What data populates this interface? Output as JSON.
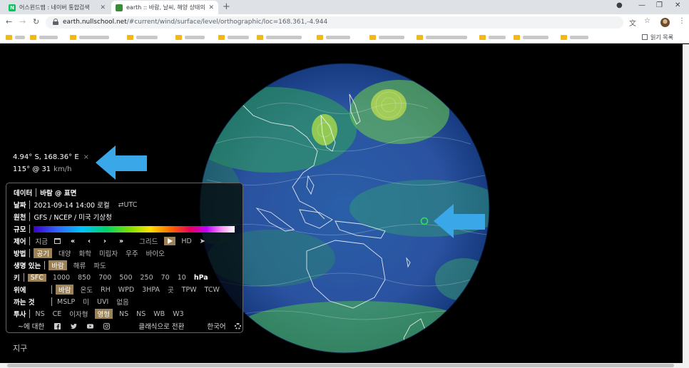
{
  "browser": {
    "tabs": [
      {
        "favicon_letter": "N",
        "favicon_color": "#03c75a",
        "title": "어스윈드맵 : 네이버 통합검색"
      },
      {
        "favicon_color": "#3b8a3a",
        "title": "earth :: 바람, 날씨, 해양 상태의"
      }
    ],
    "new_tab": "+",
    "url_host": "earth.nullschool.net",
    "url_path": "/#current/wind/surface/level/orthographic/loc=168.361,-4.944",
    "reading_list": "읽기 목록"
  },
  "spot": {
    "coords": "4.94° S, 168.36° E",
    "close": "×",
    "wind": "115° @ 31",
    "unit": "km/h"
  },
  "menu": {
    "data": {
      "label": "데이터",
      "value": "바람 @ 표면"
    },
    "date": {
      "label": "날짜",
      "value": "2021-09-14 14:00 로컬",
      "toggle": "⇄UTC"
    },
    "source": {
      "label": "원천",
      "value": "GFS / NCEP / 미국 기상청"
    },
    "scale": {
      "label": "규모"
    },
    "control": {
      "label": "제어",
      "now": "지금",
      "prev_day": "«",
      "prev": "‹",
      "next": "›",
      "next_day": "»",
      "grid": "그리드",
      "hd": "HD"
    },
    "mode": {
      "label": "방법",
      "options": [
        "공기",
        "대양",
        "화학",
        "미립자",
        "우주",
        "바이오"
      ]
    },
    "animate": {
      "label": "생명 있는",
      "options": [
        "바람",
        "해류",
        "파도"
      ]
    },
    "height": {
      "label": "키",
      "options": [
        "SFC",
        "1000",
        "850",
        "700",
        "500",
        "250",
        "70",
        "10"
      ],
      "unit": "hPa"
    },
    "overlay": {
      "label1": "위에",
      "label2": "까는 것",
      "row1": [
        "바람",
        "온도",
        "RH",
        "WPD",
        "3HPA",
        "곳",
        "TPW",
        "TCW"
      ],
      "row2": [
        "MSLP",
        "미",
        "UVI",
        "없음"
      ]
    },
    "projection": {
      "label": "투사",
      "options": [
        "NS",
        "CE",
        "이자형",
        "영형",
        "NS",
        "NS",
        "WB",
        "W3"
      ]
    },
    "about": "~에 대한",
    "classic": "클래식으로 전환",
    "language": "한국어"
  },
  "footer": {
    "title": "지구"
  },
  "colors": {
    "accent": "#9c8357",
    "arrow": "#3aa8e8",
    "marker": "#2ee05a"
  }
}
